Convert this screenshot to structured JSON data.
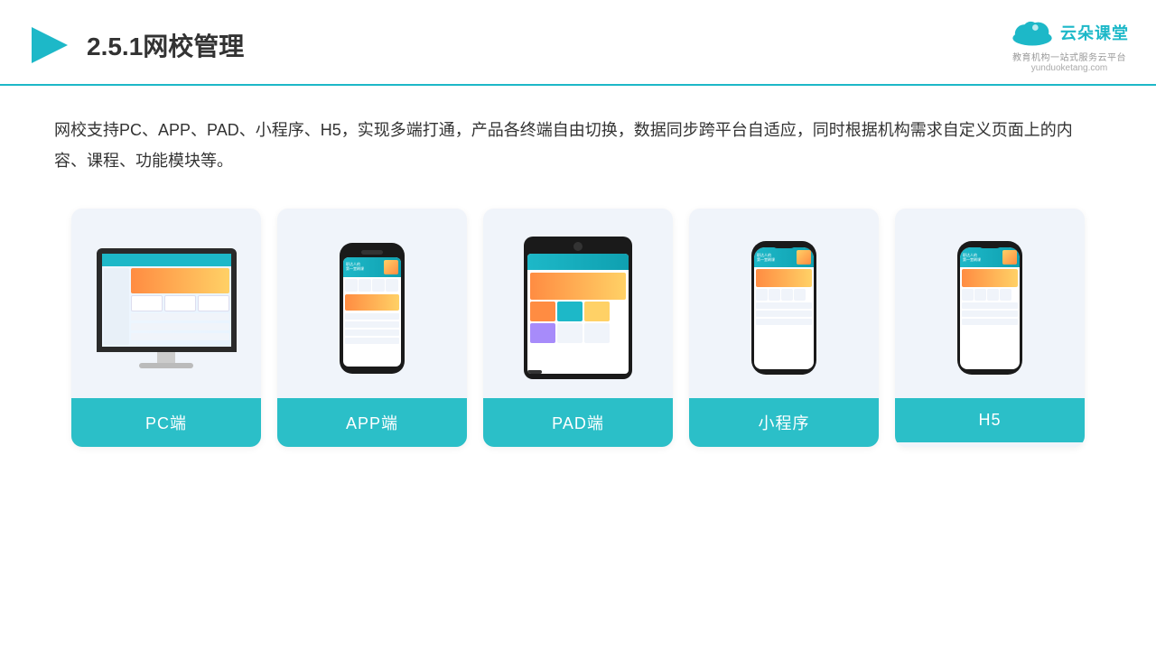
{
  "header": {
    "title": "2.5.1网校管理",
    "logo_name": "云朵课堂",
    "logo_url": "yunduoketang.com",
    "logo_tagline": "教育机构一站式服务云平台"
  },
  "description": {
    "text": "网校支持PC、APP、PAD、小程序、H5，实现多端打通，产品各终端自由切换，数据同步跨平台自适应，同时根据机构需求自定义页面上的内容、课程、功能模块等。"
  },
  "cards": [
    {
      "label": "PC端"
    },
    {
      "label": "APP端"
    },
    {
      "label": "PAD端"
    },
    {
      "label": "小程序"
    },
    {
      "label": "H5"
    }
  ]
}
